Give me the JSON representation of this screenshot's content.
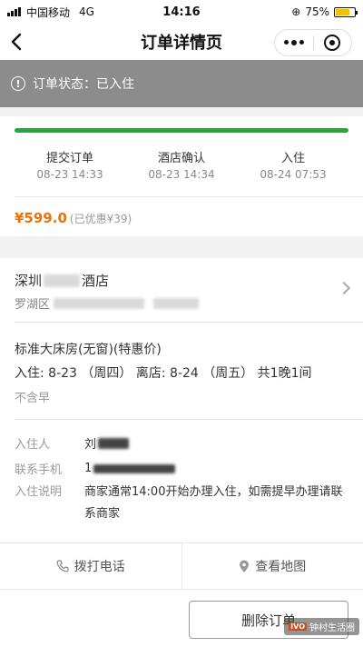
{
  "status_bar": {
    "carrier": "中国移动",
    "network": "4G",
    "time": "14:16",
    "battery": "75%",
    "battery_level": 0.75
  },
  "nav": {
    "title": "订单详情页"
  },
  "order_status": {
    "label": "订单状态：",
    "value": "已入住"
  },
  "progress": {
    "fraction": 1.0,
    "color": "#1aad3c",
    "steps": [
      {
        "label": "提交订单",
        "time": "08-23 14:33"
      },
      {
        "label": "酒店确认",
        "time": "08-23 14:34"
      },
      {
        "label": "入住",
        "time": "08-24 07:53"
      }
    ]
  },
  "price": {
    "amount": "¥599.0",
    "discount": "(已优惠¥39)",
    "color": "#e8730c"
  },
  "hotel": {
    "name_prefix": "深圳",
    "name_suffix": "酒店",
    "address_prefix": "罗湖区"
  },
  "room": {
    "type": "标准大床房(无窗)(特惠价)",
    "dates": "入住: 8-23 （周四） 离店: 8-24 （周五） 共1晚1间",
    "breakfast": "不含早"
  },
  "guest": {
    "name_label": "入住人",
    "name_value": "刘",
    "phone_label": "联系手机",
    "phone_value": "1",
    "note_label": "入住说明",
    "note_value": "商家通常14:00开始办理入住，如需提早办理请联系商家"
  },
  "actions": {
    "call": "拨打电话",
    "map": "查看地图"
  },
  "footer": {
    "delete": "删除订单",
    "watermark": "钟村生活圈",
    "watermark_logo": "IVO"
  }
}
